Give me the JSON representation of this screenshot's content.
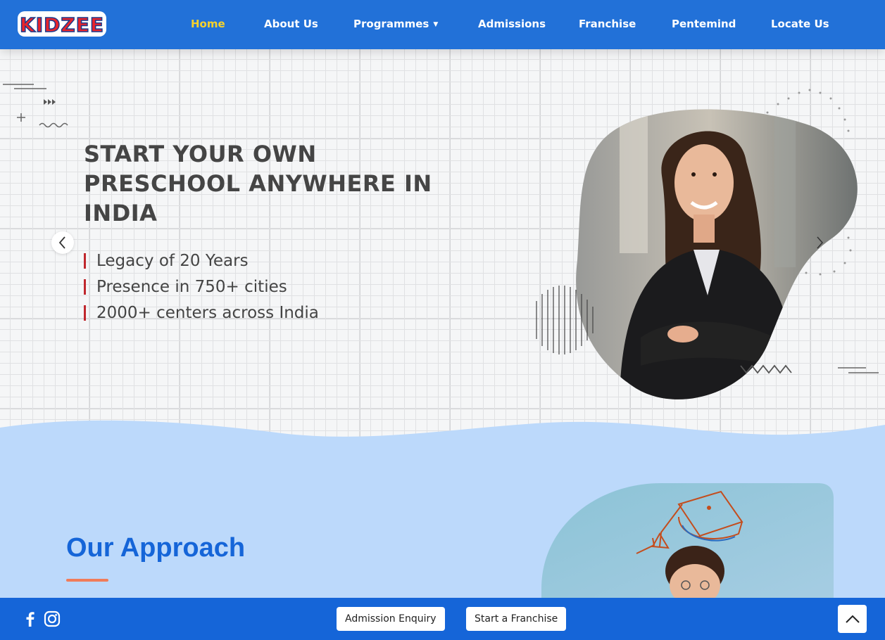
{
  "header": {
    "logo_text": "KIDZEE",
    "nav": [
      {
        "label": "Home",
        "active": true
      },
      {
        "label": "About Us"
      },
      {
        "label": "Programmes",
        "has_dropdown": true
      },
      {
        "label": "Admissions"
      },
      {
        "label": "Franchise"
      },
      {
        "label": "Pentemind"
      },
      {
        "label": "Locate Us"
      }
    ]
  },
  "hero": {
    "title": "START YOUR OWN PRESCHOOL ANYWHERE IN INDIA",
    "features": [
      "Legacy of 20 Years",
      "Presence in 750+ cities",
      "2000+ centers across India"
    ]
  },
  "approach": {
    "title": "Our Approach"
  },
  "footer_bar": {
    "admission_label": "Admission Enquiry",
    "franchise_label": "Start a Franchise"
  },
  "colors": {
    "primary_blue": "#2271d8",
    "nav_active": "#f6d22c",
    "section_bg": "#bcd9fb",
    "accent_red": "#c0272d",
    "accent_orange": "#f07c5a"
  }
}
